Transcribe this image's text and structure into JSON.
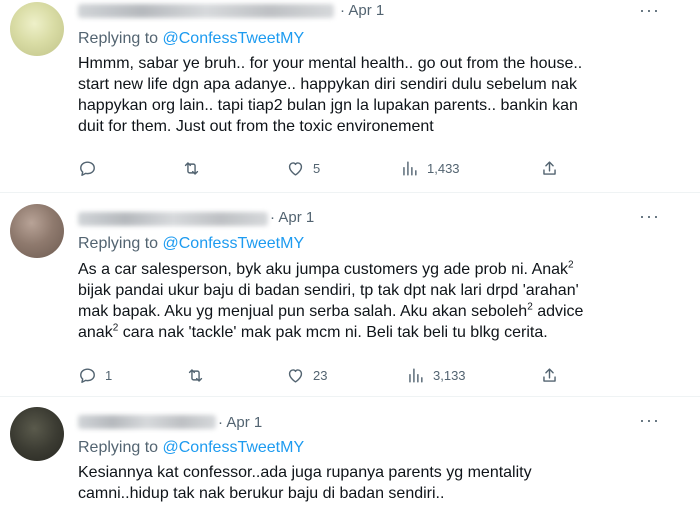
{
  "tweets": [
    {
      "date": "Apr 1",
      "replying_prefix": "Replying to ",
      "replying_handle": "@ConfessTweetMY",
      "lines": [
        "Hmmm, sabar ye bruh.. for your mental health.. go out from the house..",
        "start new life dgn apa adanye.. happykan diri sendiri dulu sebelum nak",
        "happykan org lain.. tapi tiap2 bulan jgn la lupakan parents.. bankin kan",
        "duit for them. Just out from the toxic environement"
      ],
      "replies": "",
      "retweets": "",
      "likes": "5",
      "views": "1,433"
    },
    {
      "date": "Apr 1",
      "replying_prefix": "Replying to ",
      "replying_handle": "@ConfessTweetMY",
      "lines": [
        "As a car salesperson, byk aku jumpa customers yg ade prob ni. Anak",
        "bijak pandai ukur baju di badan sendiri, tp tak dpt nak lari drpd 'arahan'",
        "mak bapak. Aku yg menjual pun serba salah. Aku akan seboleh",
        "anak",
        "cara nak 'tackle' mak pak mcm ni. Beli tak beli tu blkg cerita."
      ],
      "sup": "2",
      "line3_tail": " advice",
      "replies": "1",
      "retweets": "",
      "likes": "23",
      "views": "3,133"
    },
    {
      "date": "Apr 1",
      "replying_prefix": "Replying to ",
      "replying_handle": "@ConfessTweetMY",
      "lines": [
        "Kesiannya kat confessor..ada juga rupanya parents yg mentality",
        "camni..hidup tak nak berukur baju di badan sendiri.."
      ]
    }
  ],
  "icons": {
    "reply": "reply-icon",
    "retweet": "retweet-icon",
    "like": "heart-icon",
    "views": "views-icon",
    "share": "share-icon",
    "more": "more-icon"
  }
}
